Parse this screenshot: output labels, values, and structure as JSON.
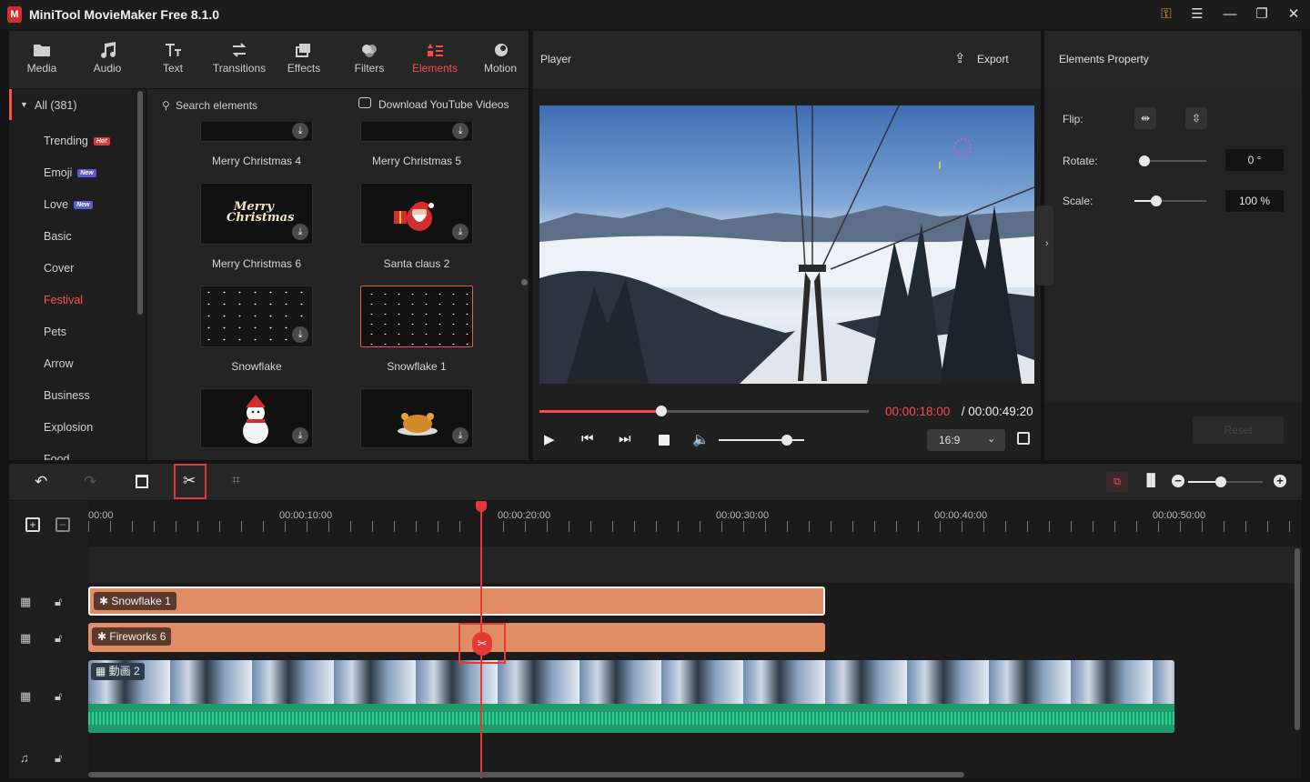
{
  "app": {
    "title": "MiniTool MovieMaker Free 8.1.0"
  },
  "toolbar": {
    "tabs": [
      {
        "label": "Media"
      },
      {
        "label": "Audio"
      },
      {
        "label": "Text"
      },
      {
        "label": "Transitions"
      },
      {
        "label": "Effects"
      },
      {
        "label": "Filters"
      },
      {
        "label": "Elements"
      },
      {
        "label": "Motion"
      }
    ],
    "active": "Elements"
  },
  "categories": {
    "all": "All (381)",
    "items": [
      {
        "label": "Trending",
        "badge": "Hot"
      },
      {
        "label": "Emoji",
        "badge": "New"
      },
      {
        "label": "Love",
        "badge": "New"
      },
      {
        "label": "Basic"
      },
      {
        "label": "Cover"
      },
      {
        "label": "Festival"
      },
      {
        "label": "Pets"
      },
      {
        "label": "Arrow"
      },
      {
        "label": "Business"
      },
      {
        "label": "Explosion"
      },
      {
        "label": "Food"
      }
    ],
    "active": "Festival"
  },
  "elements": {
    "search_placeholder": "Search elements",
    "download_youtube": "Download YouTube Videos",
    "items": [
      {
        "label": "Merry Christmas 4"
      },
      {
        "label": "Merry Christmas 5"
      },
      {
        "label": "Merry Christmas 6"
      },
      {
        "label": "Santa claus 2"
      },
      {
        "label": "Snowflake"
      },
      {
        "label": "Snowflake 1"
      }
    ],
    "thumb_text": "Merry Christmas"
  },
  "player": {
    "title": "Player",
    "export_label": "Export",
    "current_time": "00:00:18:00",
    "separator": " / ",
    "total_time": "00:00:49:20",
    "progress": 0.37,
    "volume": 0.8,
    "aspect_ratio": "16:9"
  },
  "properties": {
    "title": "Elements Property",
    "flip_label": "Flip:",
    "rotate_label": "Rotate:",
    "rotate_value": "0 °",
    "rotate_level": 0,
    "scale_label": "Scale:",
    "scale_value": "100 %",
    "scale_level": 0.3,
    "reset_label": "Reset"
  },
  "timeline": {
    "ruler": [
      "00:00",
      "00:00:10:00",
      "00:00:20:00",
      "00:00:30:00",
      "00:00:40:00",
      "00:00:50:00"
    ],
    "clips": [
      {
        "label": "Snowflake 1"
      },
      {
        "label": "Fireworks 6"
      },
      {
        "label": "動画 2"
      }
    ]
  },
  "colors": {
    "accent": "#ff4d4d",
    "clip": "#e08c64",
    "audio": "#1f9a6a"
  }
}
